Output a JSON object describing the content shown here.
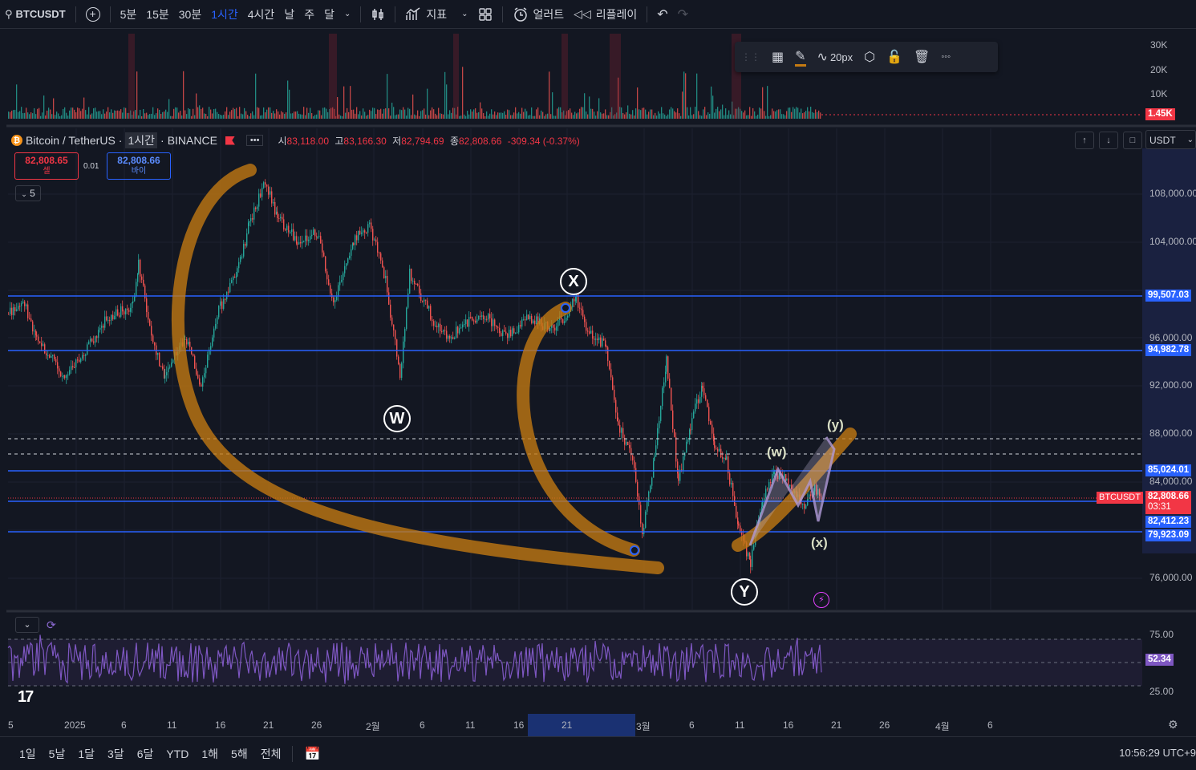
{
  "toolbar": {
    "symbol": "BTCUSDT",
    "intervals": [
      "5분",
      "15분",
      "30분",
      "1시간",
      "4시간",
      "날",
      "주",
      "달"
    ],
    "active_interval": "1시간",
    "indicators_label": "지표",
    "alert_label": "얼러트",
    "replay_label": "리플레이"
  },
  "legend": {
    "name": "Bitcoin / TetherUS",
    "interval": "1시간",
    "exchange": "BINANCE",
    "ohlc": {
      "open_label": "시",
      "open": "83,118.00",
      "high_label": "고",
      "high": "83,166.30",
      "low_label": "저",
      "low": "82,794.69",
      "close_label": "종",
      "close": "82,808.66",
      "change": "-309.34 (-0.37%)"
    },
    "sell_price": "82,808.65",
    "sell_label": "셀",
    "buy_price": "82,808.66",
    "buy_label": "바이",
    "spread": "0.01",
    "collapse_count": "5"
  },
  "drawing_toolbar": {
    "width_label": "20px"
  },
  "currency": "USDT",
  "volume_axis": [
    "30K",
    "20K",
    "10K"
  ],
  "volume_last": "1.45K",
  "price_axis": [
    "108,000.00",
    "104,000.00",
    "96,000.00",
    "92,000.00",
    "88,000.00",
    "84,000.00",
    "76,000.00"
  ],
  "price_tags": [
    {
      "value": "99,507.03",
      "color": "#2962ff"
    },
    {
      "value": "94,982.78",
      "color": "#2962ff"
    },
    {
      "value": "85,024.01",
      "color": "#2962ff"
    },
    {
      "value": "82,412.23",
      "color": "#2962ff"
    },
    {
      "value": "79,923.09",
      "color": "#2962ff"
    }
  ],
  "current_price": {
    "symbol": "BTCUSDT",
    "value": "82,808.66",
    "countdown": "03:31",
    "color": "#f23645"
  },
  "rsi_axis": [
    "75.00",
    "25.00"
  ],
  "rsi_value": "52.34",
  "wave_labels": {
    "W": "W",
    "X": "X",
    "Y": "Y",
    "w": "(w)",
    "x": "(x)",
    "y": "(y)"
  },
  "time_axis": [
    "5",
    "2025",
    "6",
    "11",
    "16",
    "21",
    "26",
    "2월",
    "6",
    "11",
    "16",
    "21",
    "3월",
    "6",
    "11",
    "16",
    "21",
    "26",
    "4월",
    "6"
  ],
  "ranges": [
    "1일",
    "5날",
    "1달",
    "3달",
    "6달",
    "YTD",
    "1해",
    "5해",
    "전체"
  ],
  "clock": "10:56:29 UTC+9",
  "colors": {
    "background": "#131722",
    "up": "#26a69a",
    "down": "#ef5350",
    "hline": "#2962ff",
    "drawing": "#c47a12",
    "rsi": "#7e57c2"
  }
}
